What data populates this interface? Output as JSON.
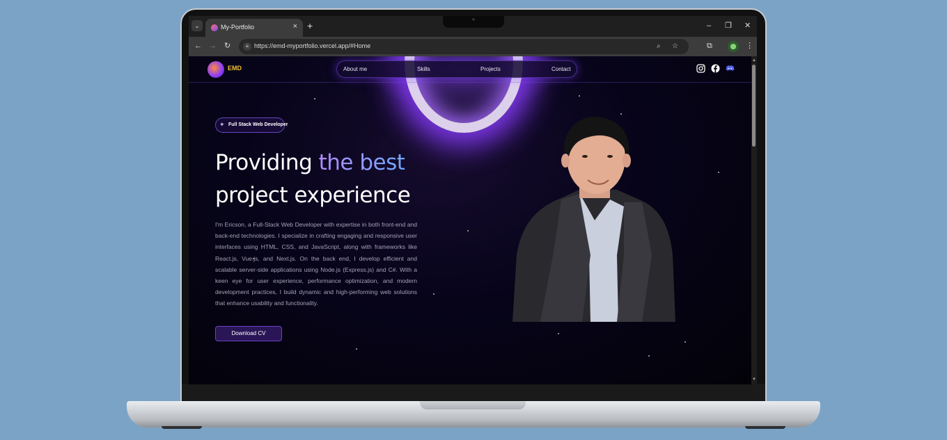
{
  "browser": {
    "tab_title": "My-Portfolio",
    "tab_close": "×",
    "new_tab": "+",
    "url": "https://emd-myportfolio.vercel.app/#Home",
    "window_controls": {
      "minimize": "–",
      "restore": "❐",
      "close": "✕"
    },
    "nav": {
      "back": "←",
      "forward": "→",
      "reload": "↻"
    }
  },
  "site": {
    "logo_text": "EMD",
    "nav_links": [
      "About me",
      "Skills",
      "Projects",
      "Contact"
    ],
    "social_icons": [
      "instagram-icon",
      "facebook-icon",
      "discord-icon"
    ],
    "badge": "Full Stack Web Developer",
    "hero_line1_plain": "Providing ",
    "hero_line1_accent": "the best",
    "hero_line2": "project experience",
    "description": "I'm Ericson, a Full-Stack Web Developer with expertise in both front-end and back-end technologies. I specialize in crafting engaging and responsive user interfaces using HTML, CSS, and JavaScript, along with frameworks like React.js, Vue.js, and Next.js. On the back end, I develop efficient and scalable server-side applications using Node.js (Express.js) and C#. With a keen eye for user experience, performance optimization, and modern development practices, I build dynamic and high-performing web solutions that enhance usability and functionality.",
    "cta_button": "Download CV"
  },
  "colors": {
    "desktop_bg": "#7ba3c6",
    "accent_purple": "#8a3cff",
    "logo_gold": "#f4c13b"
  }
}
